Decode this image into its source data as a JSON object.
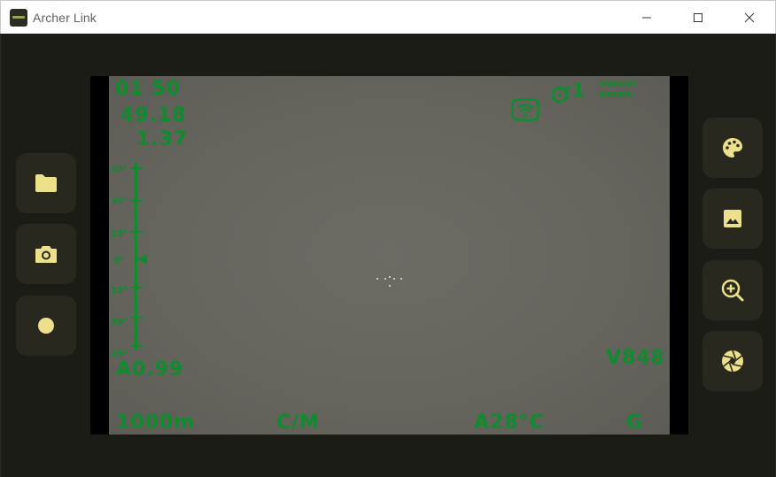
{
  "window": {
    "title": "Archer Link"
  },
  "left_toolbar": {
    "folder": {
      "icon": "folder-icon"
    },
    "photo": {
      "icon": "camera-icon"
    },
    "record": {
      "icon": "record-dot-icon"
    }
  },
  "right_toolbar": {
    "palette": {
      "icon": "palette-icon"
    },
    "gallery": {
      "icon": "image-icon"
    },
    "zoom": {
      "icon": "zoom-in-icon"
    },
    "shutter": {
      "icon": "shutter-aperture-icon"
    }
  },
  "osd": {
    "time": "01 50",
    "value1": "49.18",
    "value2": "1.37",
    "tilt_ticks": [
      "45°",
      "30°",
      "15°",
      "0°",
      "15°",
      "30°",
      "45°"
    ],
    "angle": "A0.99",
    "profile_number": "1",
    "profile_line1": "300WM",
    "profile_line2": "ARKER",
    "voltage": "V848",
    "range": "1000m",
    "units": "C/M",
    "temperature": "A28°C",
    "mode": "G"
  },
  "colors": {
    "osd_green": "#0f8c2e",
    "button_icon": "#ece08a",
    "button_bg": "#28281f",
    "app_bg": "#1c1c16"
  }
}
